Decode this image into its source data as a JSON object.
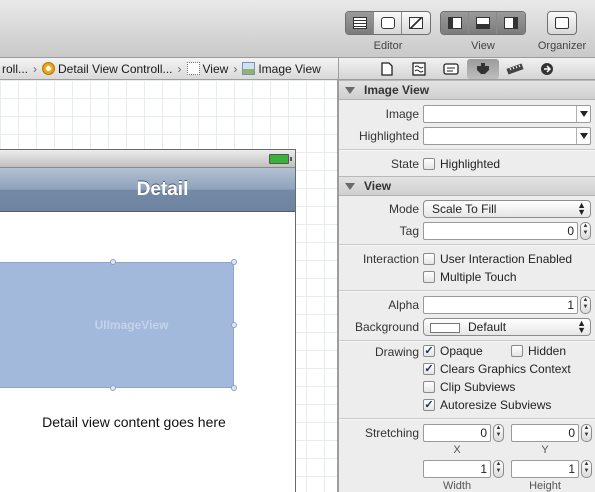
{
  "toolbar": {
    "editor_label": "Editor",
    "view_label": "View",
    "organizer_label": "Organizer"
  },
  "jumpbar": {
    "items": [
      {
        "label": "roll...",
        "icon": "storyboard-icon"
      },
      {
        "label": "Detail View Controll...",
        "icon": "view-controller-icon"
      },
      {
        "label": "View",
        "icon": "view-icon"
      },
      {
        "label": "Image View",
        "icon": "image-view-icon"
      }
    ]
  },
  "inspector_tabs": [
    "file-icon",
    "quick-help-icon",
    "identity-icon",
    "attributes-icon",
    "size-icon",
    "connections-icon"
  ],
  "canvas": {
    "nav_title": "Detail",
    "image_view_label": "UIImageView",
    "content_text": "Detail view content goes here"
  },
  "image_view_section": {
    "title": "Image View",
    "image_label": "Image",
    "image_value": "",
    "highlighted_label": "Highlighted",
    "highlighted_value": "",
    "state_label": "State",
    "state_checkbox": "Highlighted",
    "state_checked": false
  },
  "view_section": {
    "title": "View",
    "mode_label": "Mode",
    "mode_value": "Scale To Fill",
    "tag_label": "Tag",
    "tag_value": "0",
    "interaction_label": "Interaction",
    "user_interaction": {
      "label": "User Interaction Enabled",
      "checked": false
    },
    "multiple_touch": {
      "label": "Multiple Touch",
      "checked": false
    },
    "alpha_label": "Alpha",
    "alpha_value": "1",
    "background_label": "Background",
    "background_value": "Default",
    "drawing_label": "Drawing",
    "opaque": {
      "label": "Opaque",
      "checked": true
    },
    "hidden": {
      "label": "Hidden",
      "checked": false
    },
    "clears_context": {
      "label": "Clears Graphics Context",
      "checked": true
    },
    "clip_subviews": {
      "label": "Clip Subviews",
      "checked": false
    },
    "autoresize": {
      "label": "Autoresize Subviews",
      "checked": true
    },
    "stretching_label": "Stretching",
    "stretch_x": "0",
    "stretch_y": "0",
    "stretch_width": "1",
    "stretch_height": "1",
    "x_label": "X",
    "y_label": "Y",
    "width_label": "Width",
    "height_label": "Height"
  }
}
